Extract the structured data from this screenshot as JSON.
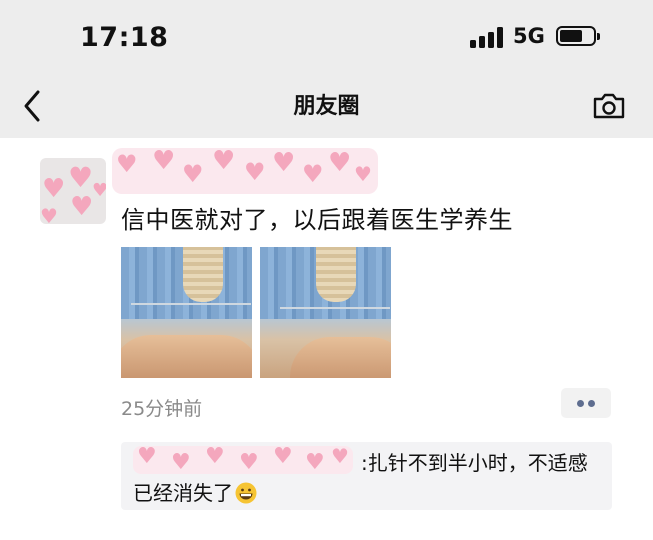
{
  "status_bar": {
    "time": "17:18",
    "network": "5G"
  },
  "nav": {
    "title": "朋友圈",
    "back_icon": "chevron-left-icon",
    "camera_icon": "camera-icon"
  },
  "post": {
    "text": "信中医就对了，以后跟着医生学养生",
    "timestamp": "25分钟前",
    "photos": [
      "photo-1",
      "photo-2"
    ],
    "more_icon": "more-dots-icon"
  },
  "comment": {
    "text": ":扎针不到半小时，不适感已经消失了",
    "emoji": "grinning-face-emoji"
  },
  "colors": {
    "bar_bg": "#ededed",
    "link_blue": "#5e6d8f",
    "mosaic_pink": "#f4a7bd",
    "comment_bg": "#f3f3f5"
  }
}
